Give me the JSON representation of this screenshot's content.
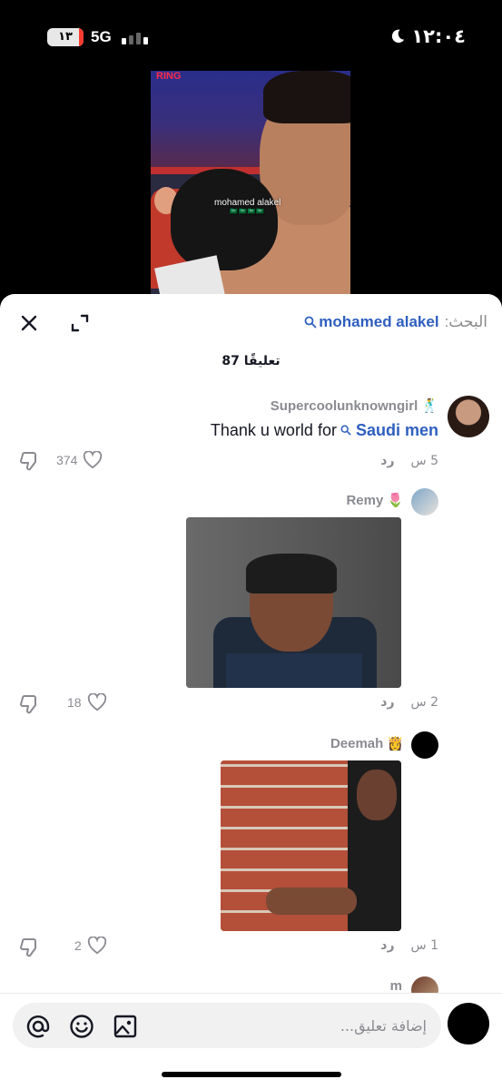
{
  "status_bar": {
    "battery": "١٣",
    "network": "5G",
    "time": "١٢:٠٤"
  },
  "video": {
    "brand_logo": "RING",
    "overlay_name": "mohamed alakel",
    "overlay_flags": "🇸🇦🇸🇦🇸🇦🇸🇦"
  },
  "sheet": {
    "search_label": "البحث:",
    "search_term": "mohamed alakel",
    "comment_count": "87 تعليقًا"
  },
  "comments": [
    {
      "username": "Supercoolunknowngirl",
      "username_emoji": "🕺",
      "text": "Thank u world for",
      "link_text": "Saudi men",
      "time": "5 س",
      "reply_label": "رد",
      "likes": "374",
      "has_media": false
    },
    {
      "username": "Remy",
      "username_emoji": "🌷",
      "time": "2 س",
      "reply_label": "رد",
      "likes": "18",
      "has_media": true
    },
    {
      "username": "Deemah",
      "username_emoji": "👸",
      "time": "1 س",
      "reply_label": "رد",
      "likes": "2",
      "has_media": true
    },
    {
      "username": "m"
    }
  ],
  "input": {
    "placeholder": "إضافة تعليق..."
  },
  "icons": {
    "close": "close-icon",
    "expand": "expand-icon",
    "search": "search-icon",
    "like": "heart-icon",
    "dislike": "thumbs-down-icon",
    "mention": "at-icon",
    "emoji": "emoji-icon",
    "image": "image-icon",
    "moon": "moon-icon"
  },
  "colors": {
    "link": "#2e5fbf",
    "muted": "#8a8b91",
    "text": "#161823"
  }
}
